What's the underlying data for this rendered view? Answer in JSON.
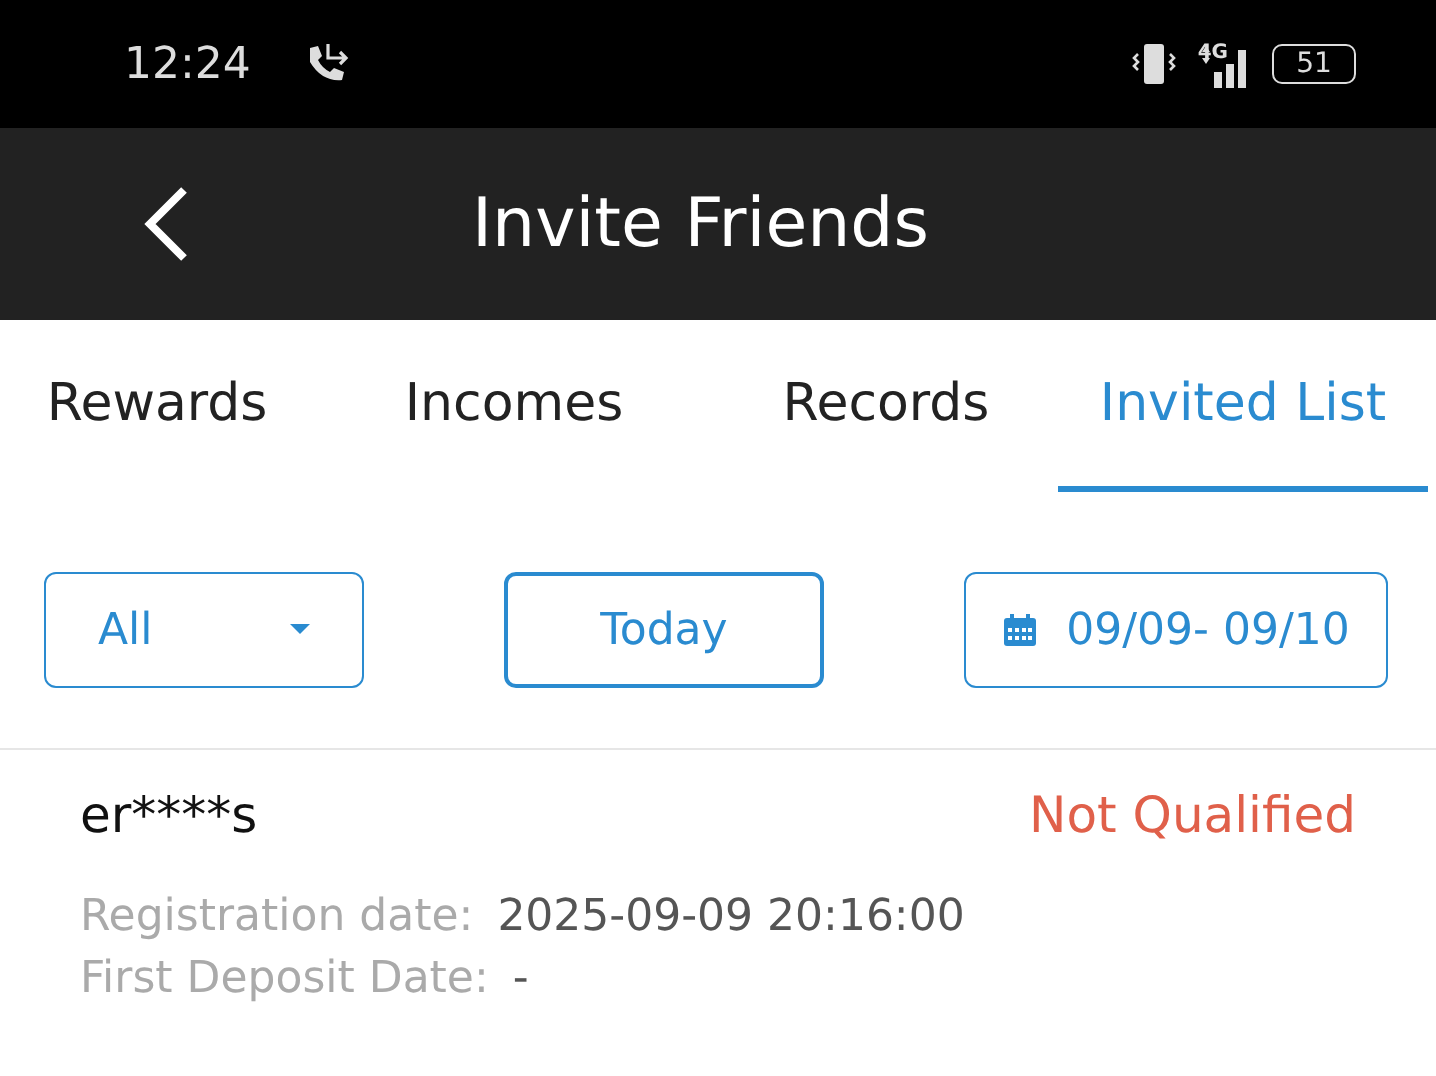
{
  "status_bar": {
    "time": "12:24",
    "network": "4G",
    "battery": "51"
  },
  "header": {
    "title": "Invite Friends"
  },
  "tabs": [
    {
      "label": "Rewards",
      "selected": false
    },
    {
      "label": "Incomes",
      "selected": false
    },
    {
      "label": "Records",
      "selected": false
    },
    {
      "label": "Invited List",
      "selected": true
    }
  ],
  "filters": [
    {
      "kind": "dropdown",
      "label": "All"
    },
    {
      "kind": "button",
      "label": "Today"
    },
    {
      "kind": "date",
      "label": "09/09- 09/10"
    }
  ],
  "records": [
    {
      "user": "er****s",
      "status": "Not Qualified",
      "fields": [
        {
          "label": "Registration date:",
          "value": "2025-09-09 20:16:00"
        },
        {
          "label": "First Deposit Date:",
          "value": "-"
        }
      ]
    }
  ]
}
